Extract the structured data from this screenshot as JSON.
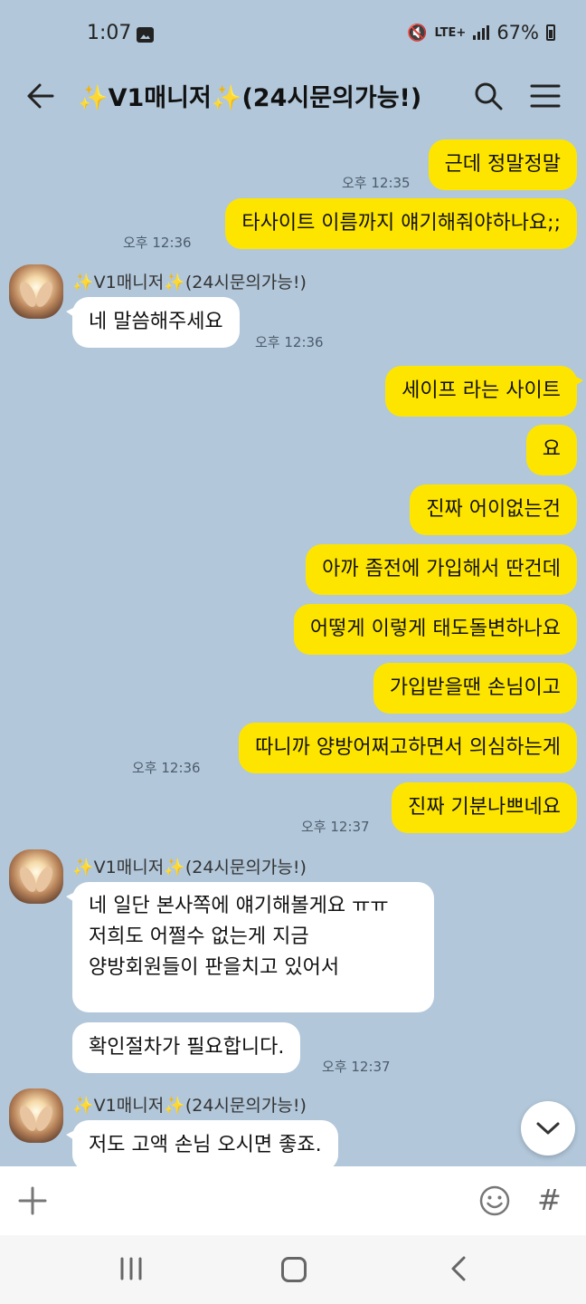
{
  "status_bar": {
    "time": "1:07",
    "network": "LTE+",
    "battery": "67%"
  },
  "header": {
    "title": "✨V1매니저✨(24시문의가능!)"
  },
  "chat": {
    "contact_name": "✨V1매니저✨(24시문의가능!)",
    "messages": [
      {
        "from": "me",
        "text": "근데 정말정말",
        "time": "오후 12:35"
      },
      {
        "from": "me",
        "text": "타사이트 이름까지 얘기해줘야하나요;;",
        "time": "오후 12:36"
      },
      {
        "from": "them",
        "text": "네 말씀해주세요",
        "time": "오후 12:36"
      },
      {
        "from": "me",
        "text": "세이프 라는 사이트"
      },
      {
        "from": "me",
        "text": "요"
      },
      {
        "from": "me",
        "text": "진짜 어이없는건"
      },
      {
        "from": "me",
        "text": "아까 좀전에 가입해서 딴건데"
      },
      {
        "from": "me",
        "text": "어떻게 이렇게 태도돌변하나요"
      },
      {
        "from": "me",
        "text": "가입받을땐 손님이고"
      },
      {
        "from": "me",
        "text": "따니까 양방어쩌고하면서 의심하는게",
        "time": "오후 12:36"
      },
      {
        "from": "me",
        "text": "진짜 기분나쁘네요",
        "time": "오후 12:37"
      },
      {
        "from": "them",
        "lines": [
          "네 일단 본사쪽에 얘기해볼게요 ㅠㅠ",
          "저희도 어쩔수 없는게 지금",
          "양방회원들이 판을치고 있어서"
        ]
      },
      {
        "from": "them",
        "text": "확인절차가 필요합니다.",
        "time": "오후 12:37"
      },
      {
        "from": "them",
        "text": "저도 고액 손님 오시면 좋죠."
      }
    ]
  },
  "input_bar": {
    "hash_symbol": "#"
  }
}
